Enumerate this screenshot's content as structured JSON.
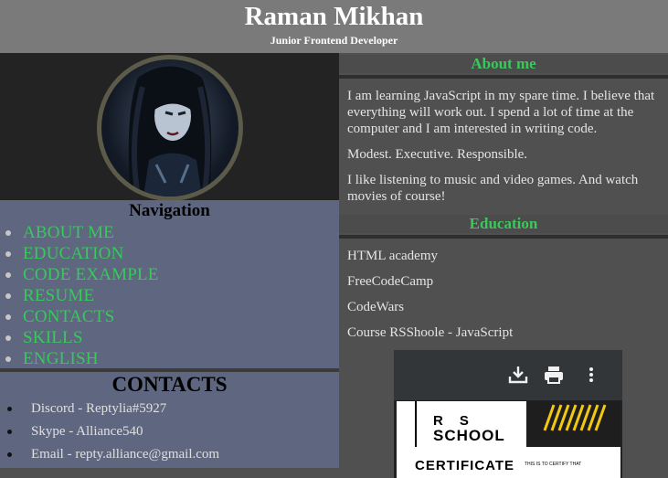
{
  "header": {
    "title": "Raman Mikhan",
    "subtitle": "Junior Frontend Developer"
  },
  "avatar": {
    "icon": "profile-photo"
  },
  "navigation": {
    "title": "Navigation",
    "items": [
      {
        "label": "ABOUT ME"
      },
      {
        "label": "EDUCATION"
      },
      {
        "label": "CODE EXAMPLE"
      },
      {
        "label": "RESUME"
      },
      {
        "label": "CONTACTS"
      },
      {
        "label": "SKILLS"
      },
      {
        "label": "ENGLISH"
      }
    ]
  },
  "contacts": {
    "title": "CONTACTS",
    "items": [
      "Discord - Reptylia#5927",
      "Skype - Alliance540",
      "Email - repty.alliance@gmail.com"
    ]
  },
  "about": {
    "title": "About me",
    "paragraphs": [
      "I am learning JavaScript in my spare time. I believe that everything will work out. I spend a lot of time at the computer and I am interested in writing code.",
      "Modest. Executive. Responsible.",
      "I like listening to music and video games. And watch movies of course!"
    ]
  },
  "education": {
    "title": "Education",
    "items": [
      "HTML academy",
      "FreeCodeCamp",
      "CodeWars",
      "Course RSShoole - JavaScript"
    ]
  },
  "certificate": {
    "toolbar_icons": [
      "download-icon",
      "print-icon",
      "more-vert-icon"
    ],
    "logo_top": "RS",
    "logo_bottom": "SCHOOL",
    "heading": "CERTIFICATE",
    "small_text": "THIS IS TO CERTIFY THAT"
  },
  "colors": {
    "accent": "#38c95a",
    "nav_background": "#5e6680",
    "header_background": "#7a7a7a",
    "page_background": "#505050"
  }
}
